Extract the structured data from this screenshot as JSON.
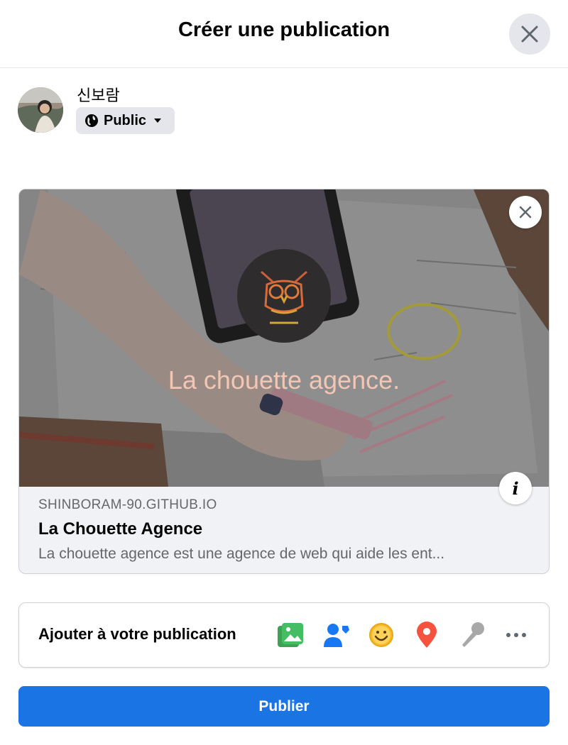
{
  "dialog": {
    "title": "Créer une publication",
    "close_icon": "close-icon"
  },
  "author": {
    "name": "신보람",
    "privacy_label": "Public",
    "privacy_icon": "globe-icon"
  },
  "link_preview": {
    "image_tagline": "La chouette agence.",
    "domain": "SHINBORAM-90.GITHUB.IO",
    "title": "La Chouette Agence",
    "description": "La chouette agence est une agence de web qui aide les ent...",
    "logo_icon": "owl-logo-icon"
  },
  "add_to_post": {
    "label": "Ajouter à votre publication",
    "tools": [
      "photo-video-icon",
      "tag-people-icon",
      "feeling-icon",
      "check-in-icon",
      "live-video-icon",
      "more-icon"
    ]
  },
  "publish": {
    "label": "Publier"
  },
  "colors": {
    "primary": "#1b74e4",
    "photo": "#45bd62",
    "tag": "#1877f2",
    "feeling": "#f7b928",
    "location": "#f5533d",
    "live": "#a8a8a8"
  }
}
